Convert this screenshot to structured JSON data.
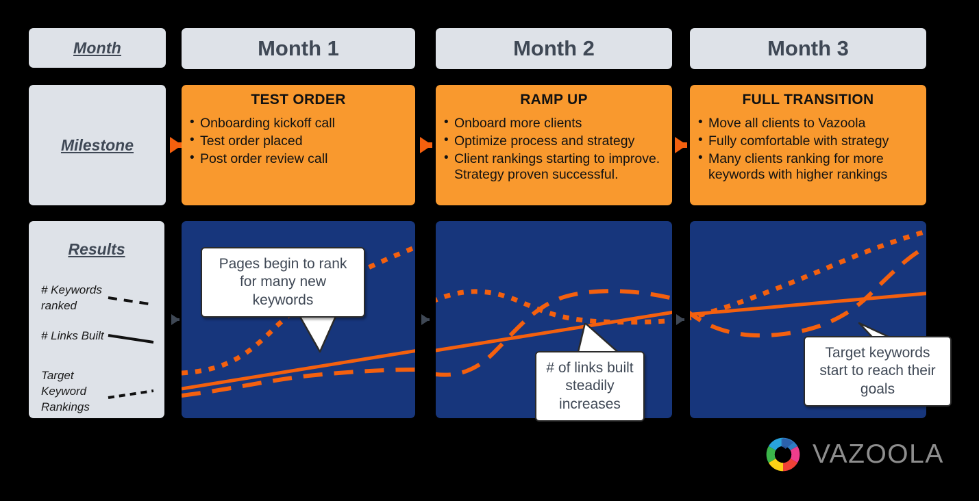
{
  "colors": {
    "background": "#000000",
    "panel_gray": "#dee2e8",
    "milestone_orange": "#f9992e",
    "results_blue": "#17367c",
    "line_orange": "#f4600e",
    "text_slate": "#3f4855",
    "callout_white": "#ffffff"
  },
  "header": {
    "row_label": "Month",
    "months": [
      "Month 1",
      "Month 2",
      "Month 3"
    ]
  },
  "milestone": {
    "row_label": "Milestone",
    "cards": [
      {
        "title": "TEST ORDER",
        "bullets": [
          "Onboarding kickoff call",
          "Test order placed",
          "Post order review call"
        ]
      },
      {
        "title": "RAMP UP",
        "bullets": [
          "Onboard more clients",
          "Optimize process and strategy",
          "Client rankings starting to improve. Strategy proven successful."
        ]
      },
      {
        "title": "FULL TRANSITION",
        "bullets": [
          "Move all clients to Vazoola",
          "Fully comfortable with strategy",
          "Many clients ranking for more keywords with higher rankings"
        ]
      }
    ]
  },
  "results": {
    "row_label": "Results",
    "legend": [
      {
        "label": "# Keywords ranked",
        "style": "long-dash"
      },
      {
        "label": "# Links Built",
        "style": "solid"
      },
      {
        "label": "Target Keyword Rankings",
        "style": "short-dash"
      }
    ],
    "callouts": [
      {
        "text": "Pages begin to rank for many new keywords",
        "panel": 1
      },
      {
        "text": "# of links built steadily increases",
        "panel": 2
      },
      {
        "text": "Target keywords start to reach their goals",
        "panel": 3
      }
    ]
  },
  "chart_data": {
    "type": "line",
    "title": "SEO results over three months",
    "xlabel": "",
    "ylabel": "",
    "x": [
      0,
      1,
      2,
      3,
      4,
      5,
      6,
      7,
      8,
      9,
      10,
      11,
      12
    ],
    "xlim": [
      0,
      12
    ],
    "ylim": [
      0,
      100
    ],
    "grid": false,
    "legend_position": "left-panel",
    "panels": [
      "Month 1",
      "Month 2",
      "Month 3"
    ],
    "series": [
      {
        "name": "# Links Built",
        "style": "solid",
        "color": "#f4600e",
        "values": [
          18,
          22,
          26,
          30,
          34,
          38,
          42,
          46,
          50,
          54,
          58,
          62,
          66
        ]
      },
      {
        "name": "Target Keyword Rankings",
        "style": "short-dash",
        "color": "#f4600e",
        "values": [
          26,
          33,
          44,
          56,
          66,
          72,
          74,
          71,
          66,
          63,
          68,
          80,
          93
        ]
      },
      {
        "name": "# Keywords ranked",
        "style": "long-dash",
        "color": "#f4600e",
        "values": [
          8,
          11,
          15,
          19,
          22,
          24,
          34,
          52,
          65,
          66,
          58,
          53,
          62
        ]
      }
    ]
  },
  "branding": {
    "logo_name": "vazoola-ring-logo",
    "wordmark": "VAZOOLA"
  }
}
